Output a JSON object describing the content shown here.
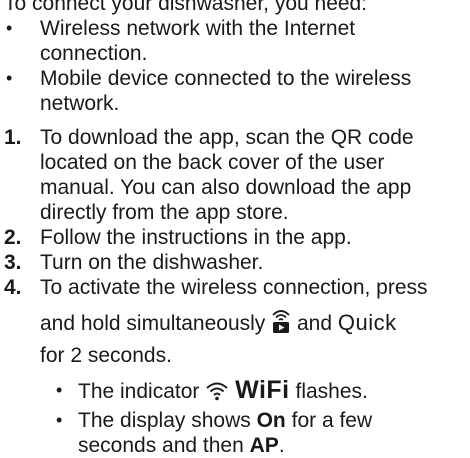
{
  "intro": "To connect your dishwasher, you need:",
  "requirements": [
    "Wireless network with the Internet connection.",
    "Mobile device connected to the wireless network."
  ],
  "bullet_char": "•",
  "steps": [
    {
      "num": "1.",
      "text": "To download the app, scan the QR code located on the back cover of the user manual. You can also download the app directly from the app store."
    },
    {
      "num": "2.",
      "text": "Follow the instructions in the app."
    },
    {
      "num": "3.",
      "text": "Turn on the dishwasher."
    },
    {
      "num": "4.",
      "line1": "To activate the wireless connection, press",
      "line2_a": "and hold simultaneously",
      "line2_b": "and",
      "quick": "Quick",
      "line2_c": "for 2 seconds."
    }
  ],
  "substeps": {
    "indicator_a": "The indicator",
    "wifi_label": "WiFi",
    "indicator_b": "flashes.",
    "display_a": "The display shows",
    "on_label": "On",
    "display_b": "for a few seconds and then",
    "ap_label": "AP",
    "display_c": "."
  },
  "icons": {
    "remote_start": "wifi-remote-start-icon",
    "wifi": "wifi-signal-icon"
  }
}
